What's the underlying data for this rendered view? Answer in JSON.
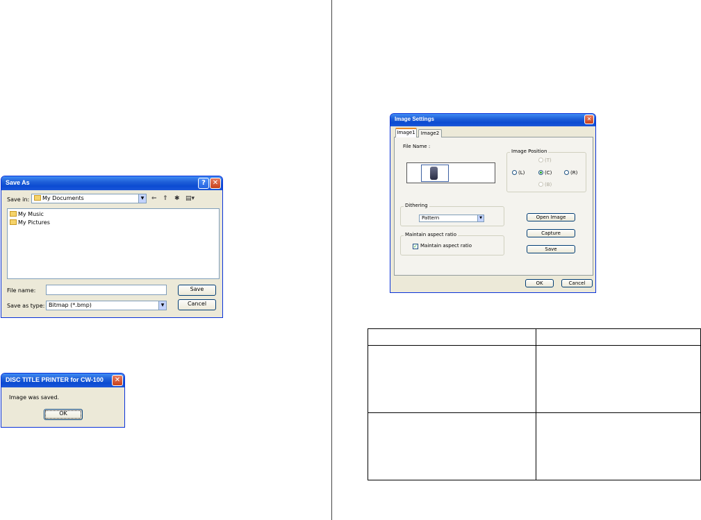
{
  "save_as_dialog": {
    "title": "Save As",
    "save_in_label": "Save in:",
    "save_in_value": "My Documents",
    "items": [
      {
        "label": "My Music"
      },
      {
        "label": "My Pictures"
      }
    ],
    "file_name_label": "File name:",
    "file_name_value": "",
    "save_as_type_label": "Save as type:",
    "save_as_type_value": "Bitmap (*.bmp)",
    "save_button": "Save",
    "cancel_button": "Cancel",
    "help_glyph": "?",
    "close_glyph": "✕"
  },
  "message_box": {
    "title": "DISC TITLE PRINTER for CW-100",
    "message": "Image was saved.",
    "ok_button": "OK",
    "close_glyph": "✕"
  },
  "image_settings_dialog": {
    "title": "Image Settings",
    "tabs": [
      {
        "label": "Image1",
        "active": true
      },
      {
        "label": "Image2",
        "active": false
      }
    ],
    "file_name_label": "File Name :",
    "image_position": {
      "title": "Image Position",
      "options": [
        {
          "label": "(T)",
          "state": "disabled"
        },
        {
          "label": "(L)",
          "state": "enabled"
        },
        {
          "label": "(C)",
          "state": "checked"
        },
        {
          "label": "(R)",
          "state": "enabled"
        },
        {
          "label": "(B)",
          "state": "disabled"
        }
      ]
    },
    "dithering": {
      "title": "Dithering",
      "value": "Pattern"
    },
    "aspect": {
      "title": "Maintain aspect ratio",
      "checkbox_label": "Maintain aspect ratio",
      "checked": true
    },
    "buttons": {
      "open_image": "Open Image",
      "capture": "Capture",
      "save": "Save",
      "ok": "OK",
      "cancel": "Cancel"
    },
    "close_glyph": "✕"
  }
}
